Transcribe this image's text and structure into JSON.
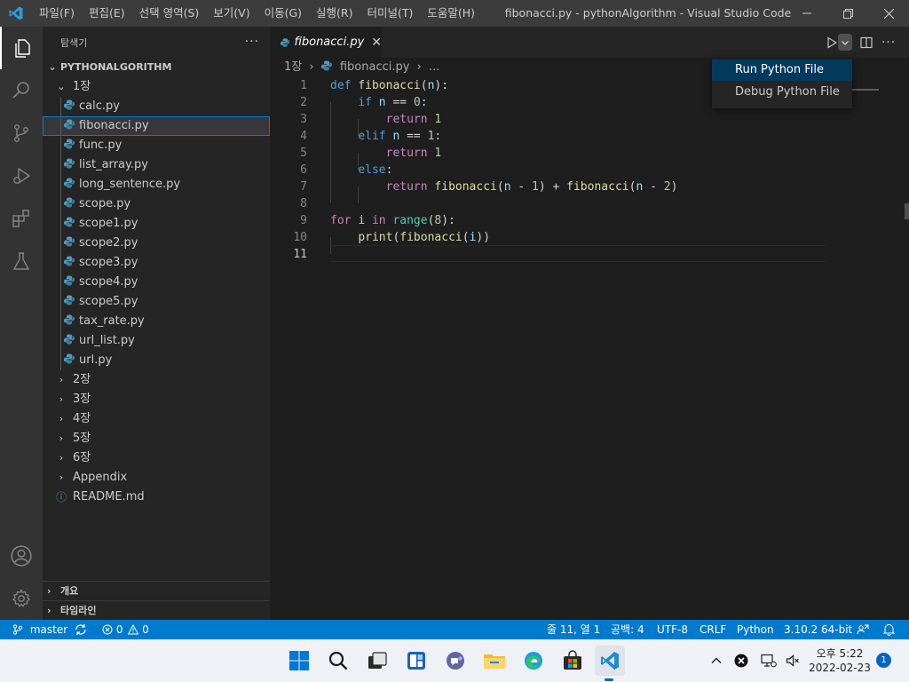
{
  "titlebar": {
    "menus": [
      "파일(F)",
      "편집(E)",
      "선택 영역(S)",
      "보기(V)",
      "이동(G)",
      "실행(R)",
      "터미널(T)",
      "도움말(H)"
    ],
    "window_title": "fibonacci.py - pythonAlgorithm - Visual Studio Code"
  },
  "sidebar": {
    "header": "탐색기",
    "root": "PYTHONALGORITHM",
    "open_folder": "1장",
    "files": [
      "calc.py",
      "fibonacci.py",
      "func.py",
      "list_array.py",
      "long_sentence.py",
      "scope.py",
      "scope1.py",
      "scope2.py",
      "scope3.py",
      "scope4.py",
      "scope5.py",
      "tax_rate.py",
      "url_list.py",
      "url.py"
    ],
    "selected_file": "fibonacci.py",
    "folders": [
      "2장",
      "3장",
      "4장",
      "5장",
      "6장",
      "Appendix"
    ],
    "readme": "README.md",
    "sections": [
      "개요",
      "타임라인"
    ]
  },
  "editor": {
    "tab_label": "fibonacci.py",
    "breadcrumb": {
      "folder": "1장",
      "file": "fibonacci.py",
      "more": "..."
    },
    "line_numbers": [
      "1",
      "2",
      "3",
      "4",
      "5",
      "6",
      "7",
      "8",
      "9",
      "10",
      "11"
    ],
    "current_line": 11,
    "code_lines": [
      "def fibonacci(n):",
      "    if n == 0:",
      "        return 1",
      "    elif n == 1:",
      "        return 1",
      "    else:",
      "        return fibonacci(n - 1) + fibonacci(n - 2)",
      "",
      "for i in range(8):",
      "    print(fibonacci(i))",
      ""
    ]
  },
  "run_menu": {
    "items": [
      "Run Python File",
      "Debug Python File"
    ],
    "highlighted": "Run Python File"
  },
  "statusbar": {
    "branch": "master",
    "errors": "0",
    "warnings": "0",
    "position": "줄 11, 열 1",
    "spaces": "공백: 4",
    "encoding": "UTF-8",
    "eol": "CRLF",
    "language": "Python",
    "interpreter": "3.10.2 64-bit"
  },
  "taskbar": {
    "time": "오후 5:22",
    "date": "2022-02-23",
    "notifications": "1"
  },
  "colors": {
    "accent": "#007acc",
    "selection_border": "#007fd4",
    "menu_highlight": "#04395e"
  }
}
